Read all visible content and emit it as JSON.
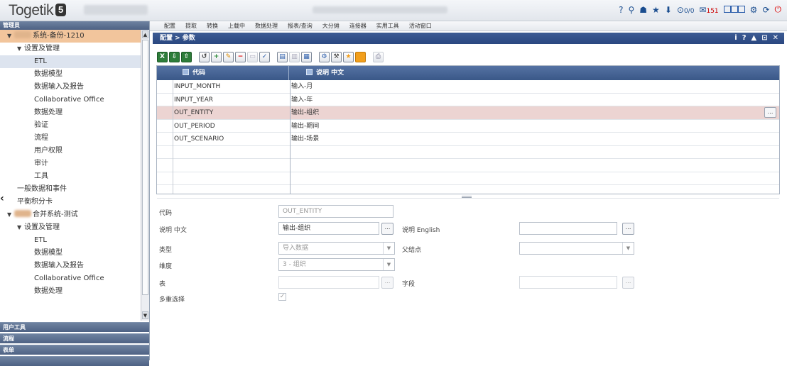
{
  "app": {
    "logo_text": "Togetik",
    "logo_badge": "5",
    "mail_count": "151",
    "task_count": "0/0"
  },
  "sidebar": {
    "header": "管理员",
    "tree": [
      {
        "label": "系统-备份-1210",
        "level": 0,
        "caret": "▼",
        "state": "selected-top"
      },
      {
        "label": "设置及管理",
        "level": 1,
        "caret": "▼"
      },
      {
        "label": "ETL",
        "level": 2,
        "state": "selected"
      },
      {
        "label": "数据模型",
        "level": 2
      },
      {
        "label": "数据输入及报告",
        "level": 2
      },
      {
        "label": "Collaborative Office",
        "level": 2
      },
      {
        "label": "数据处理",
        "level": 2
      },
      {
        "label": "验证",
        "level": 2
      },
      {
        "label": "流程",
        "level": 2
      },
      {
        "label": "用户权限",
        "level": 2
      },
      {
        "label": "审计",
        "level": 2
      },
      {
        "label": "工具",
        "level": 2
      },
      {
        "label": "一般数据和事件",
        "level": 1
      },
      {
        "label": "平衡积分卡",
        "level": 1
      },
      {
        "label": "合并系统-测试",
        "level": 0,
        "caret": "▼"
      },
      {
        "label": "设置及管理",
        "level": 1,
        "caret": "▼"
      },
      {
        "label": "ETL",
        "level": 2
      },
      {
        "label": "数据模型",
        "level": 2
      },
      {
        "label": "数据输入及报告",
        "level": 2
      },
      {
        "label": "Collaborative Office",
        "level": 2
      },
      {
        "label": "数据处理",
        "level": 2
      }
    ],
    "bottom_sections": [
      "用户工具",
      "流程",
      "表单",
      ""
    ]
  },
  "menubar": [
    "配置",
    "提取",
    "转换",
    "上载中",
    "数据处理",
    "报表/查询",
    "大分摊",
    "连接器",
    "实用工具",
    "活动窗口"
  ],
  "panel": {
    "title": "配置 > 参数",
    "controls": [
      "i",
      "?",
      "▲",
      "⊡",
      "✕"
    ]
  },
  "grid": {
    "col_code": "代码",
    "col_desc": "说明 中文",
    "rows": [
      {
        "code": "INPUT_MONTH",
        "desc": "输入-月"
      },
      {
        "code": "INPUT_YEAR",
        "desc": "输入-年"
      },
      {
        "code": "OUT_ENTITY",
        "desc": "输出-组织",
        "selected": true
      },
      {
        "code": "OUT_PERIOD",
        "desc": "输出-期间"
      },
      {
        "code": "OUT_SCENARIO",
        "desc": "输出-场景"
      },
      {
        "code": "",
        "desc": ""
      },
      {
        "code": "",
        "desc": ""
      },
      {
        "code": "",
        "desc": ""
      },
      {
        "code": "",
        "desc": ""
      }
    ]
  },
  "form": {
    "code_label": "代码",
    "code_value": "OUT_ENTITY",
    "desc_cn_label": "说明 中文",
    "desc_cn_value": "输出-组织",
    "desc_en_label": "说明 English",
    "desc_en_value": "",
    "type_label": "类型",
    "type_value": "导入数据",
    "parent_label": "父结点",
    "parent_value": "",
    "dim_label": "维度",
    "dim_value": "3 - 组织",
    "table_label": "表",
    "table_value": "",
    "field_label": "字段",
    "field_value": "",
    "multi_label": "多重选择",
    "multi_checked": "✓"
  }
}
